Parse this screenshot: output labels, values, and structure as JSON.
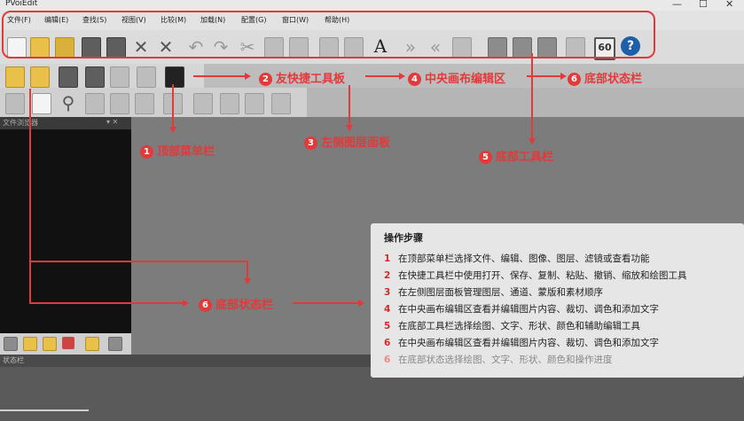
{
  "window": {
    "title": "PVoiEdit",
    "controls": [
      "—",
      "☐",
      "✕"
    ]
  },
  "menu": [
    "文件(F)",
    "编辑(E)",
    "查找(S)",
    "视图(V)",
    "比较(M)",
    "加载(N)",
    "配置(G)",
    "窗口(W)",
    "帮助(H)"
  ],
  "toolbar1": {
    "icons": [
      "new-document",
      "open-folder",
      "open-export",
      "save",
      "save-as",
      "close",
      "close-all",
      "undo",
      "redo",
      "cut",
      "copy",
      "paste",
      "screenshot",
      "list",
      "text",
      "next",
      "previous",
      "resize",
      "group-a",
      "group-b",
      "group-c",
      "timer",
      "60",
      "help"
    ],
    "text_glyph": "A",
    "badge60": "60",
    "help": "?"
  },
  "left_panel": {
    "title": "文件浏览器",
    "pin": "▾ ✕"
  },
  "status": {
    "label": "状态栏"
  },
  "annotations": {
    "top_menu": "顶部菜单栏",
    "quick_toolbar": "友快捷工具板",
    "left_layer": "左侧图层面板",
    "center_canvas": "中央画布编辑区",
    "bottom_toolbar": "底部工具栏",
    "bottom_status_top": "底部状态栏",
    "bottom_status_mid": "底部状态栏",
    "num1": "1",
    "num2": "2",
    "num3": "3",
    "num4": "4",
    "num5": "5",
    "num6a": "6",
    "num6b": "6"
  },
  "steps": {
    "title": "操作步骤",
    "items": [
      {
        "n": "1",
        "text": "在顶部菜单栏选择文件、编辑、图像、图层、滤镜或查看功能"
      },
      {
        "n": "2",
        "text": "在快捷工具栏中使用打开、保存、复制、粘贴、撤销、缩放和绘图工具"
      },
      {
        "n": "3",
        "text": "在左侧图层面板管理图层、通道、蒙版和素材顺序"
      },
      {
        "n": "4",
        "text": "在中央画布编辑区查看并编辑图片内容、裁切、调色和添加文字"
      },
      {
        "n": "5",
        "text": "在底部工具栏选择绘图、文字、形状、颜色和辅助编辑工具"
      },
      {
        "n": "6",
        "text": "在中央画布编辑区查看并编辑图片内容、裁切、调色和添加文字"
      },
      {
        "n": "6",
        "text": "在底部状态选择绘图、文字、形状、颜色和操作进度"
      }
    ]
  },
  "colors": {
    "accent": "#e03a3a"
  }
}
